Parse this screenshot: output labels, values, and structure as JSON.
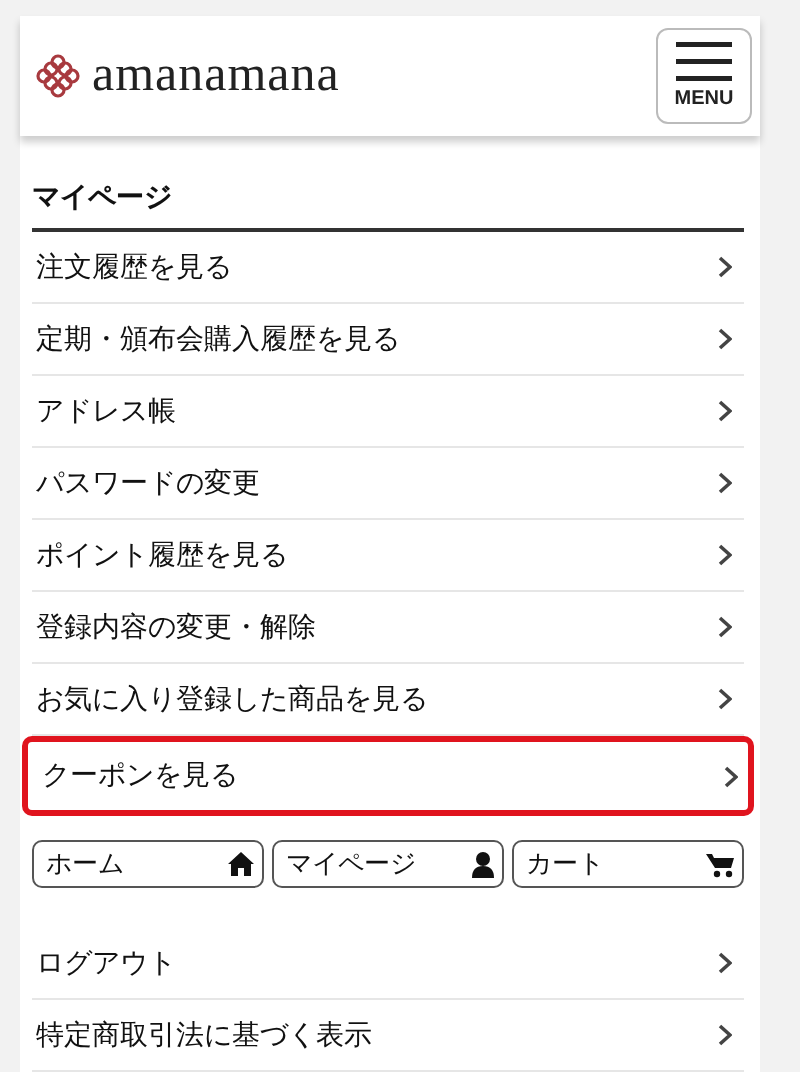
{
  "header": {
    "logo_text": "amanamana",
    "menu_label": "MENU"
  },
  "section_title": "マイページ",
  "menu_items": [
    {
      "label": "注文履歴を見る",
      "highlighted": false
    },
    {
      "label": "定期・頒布会購入履歴を見る",
      "highlighted": false
    },
    {
      "label": "アドレス帳",
      "highlighted": false
    },
    {
      "label": "パスワードの変更",
      "highlighted": false
    },
    {
      "label": "ポイント履歴を見る",
      "highlighted": false
    },
    {
      "label": "登録内容の変更・解除",
      "highlighted": false
    },
    {
      "label": "お気に入り登録した商品を見る",
      "highlighted": false
    },
    {
      "label": "クーポンを見る",
      "highlighted": true
    }
  ],
  "nav_buttons": [
    {
      "label": "ホーム",
      "kind": "home"
    },
    {
      "label": "マイページ",
      "kind": "user"
    },
    {
      "label": "カート",
      "kind": "cart"
    }
  ],
  "bottom_items": [
    {
      "label": "ログアウト"
    },
    {
      "label": "特定商取引法に基づく表示"
    }
  ]
}
